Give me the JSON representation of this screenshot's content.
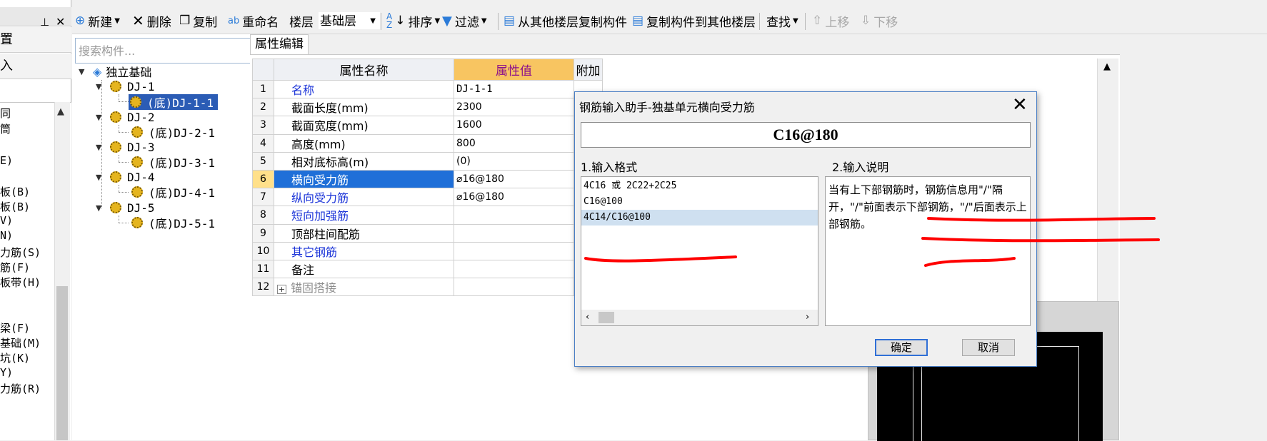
{
  "left_strip": {
    "top_items": [
      "置",
      "入"
    ],
    "list_items": [
      "同",
      "筒",
      "E)",
      "板(B)",
      "板(B)",
      "V)",
      "N)",
      "力筋(S)",
      "筋(F)",
      "板带(H)",
      "梁(F)",
      "基础(M)",
      "坑(K)",
      "Y)",
      "力筋(R)"
    ]
  },
  "toolbar": {
    "new": "新建",
    "delete": "删除",
    "copy": "复制",
    "rename": "重命名",
    "floor_label": "楼层",
    "floor_value": "基础层",
    "sort": "排序",
    "filter": "过滤",
    "copy_from_other_floor": "从其他楼层复制构件",
    "copy_to_other_floor": "复制构件到其他楼层",
    "find": "查找",
    "move_up": "上移",
    "move_down": "下移"
  },
  "tree": {
    "search_placeholder": "搜索构件...",
    "root": "独立基础",
    "groups": [
      {
        "name": "DJ-1",
        "child": "(底)DJ-1-1"
      },
      {
        "name": "DJ-2",
        "child": "(底)DJ-2-1"
      },
      {
        "name": "DJ-3",
        "child": "(底)DJ-3-1"
      },
      {
        "name": "DJ-4",
        "child": "(底)DJ-4-1"
      },
      {
        "name": "DJ-5",
        "child": "(底)DJ-5-1"
      }
    ]
  },
  "property_panel": {
    "tab": "属性编辑",
    "headers": {
      "name": "属性名称",
      "value": "属性值",
      "extra": "附加"
    },
    "rows": [
      {
        "no": "1",
        "name": "名称",
        "value": "DJ-1-1"
      },
      {
        "no": "2",
        "name": "截面长度(mm)",
        "value": "2300"
      },
      {
        "no": "3",
        "name": "截面宽度(mm)",
        "value": "1600"
      },
      {
        "no": "4",
        "name": "高度(mm)",
        "value": "800"
      },
      {
        "no": "5",
        "name": "相对底标高(m)",
        "value": "(0)"
      },
      {
        "no": "6",
        "name": "横向受力筋",
        "value": "⌀16@180"
      },
      {
        "no": "7",
        "name": "纵向受力筋",
        "value": "⌀16@180"
      },
      {
        "no": "8",
        "name": "短向加强筋",
        "value": ""
      },
      {
        "no": "9",
        "name": "顶部柱间配筋",
        "value": ""
      },
      {
        "no": "10",
        "name": "其它钢筋",
        "value": ""
      },
      {
        "no": "11",
        "name": "备注",
        "value": ""
      },
      {
        "no": "12",
        "name": "锚固搭接",
        "value": ""
      }
    ]
  },
  "dialog": {
    "title": "钢筋输入助手-独基单元横向受力筋",
    "input_value": "C16@180",
    "format_label": "1.输入格式",
    "desc_label": "2.输入说明",
    "formats": [
      "4C16 或 2C22+2C25",
      "C16@100",
      "4C14/C16@100"
    ],
    "description": "当有上下部钢筋时，钢筋信息用\"/\"隔开，\"/\"前面表示下部钢筋，\"/\"后面表示上部钢筋。",
    "ok": "确定",
    "cancel": "取消"
  },
  "colors": {
    "annotation": "#ff0000",
    "selection": "#1f6fd8",
    "value_header": "#f8c561",
    "link_text": "#1a33d8"
  }
}
